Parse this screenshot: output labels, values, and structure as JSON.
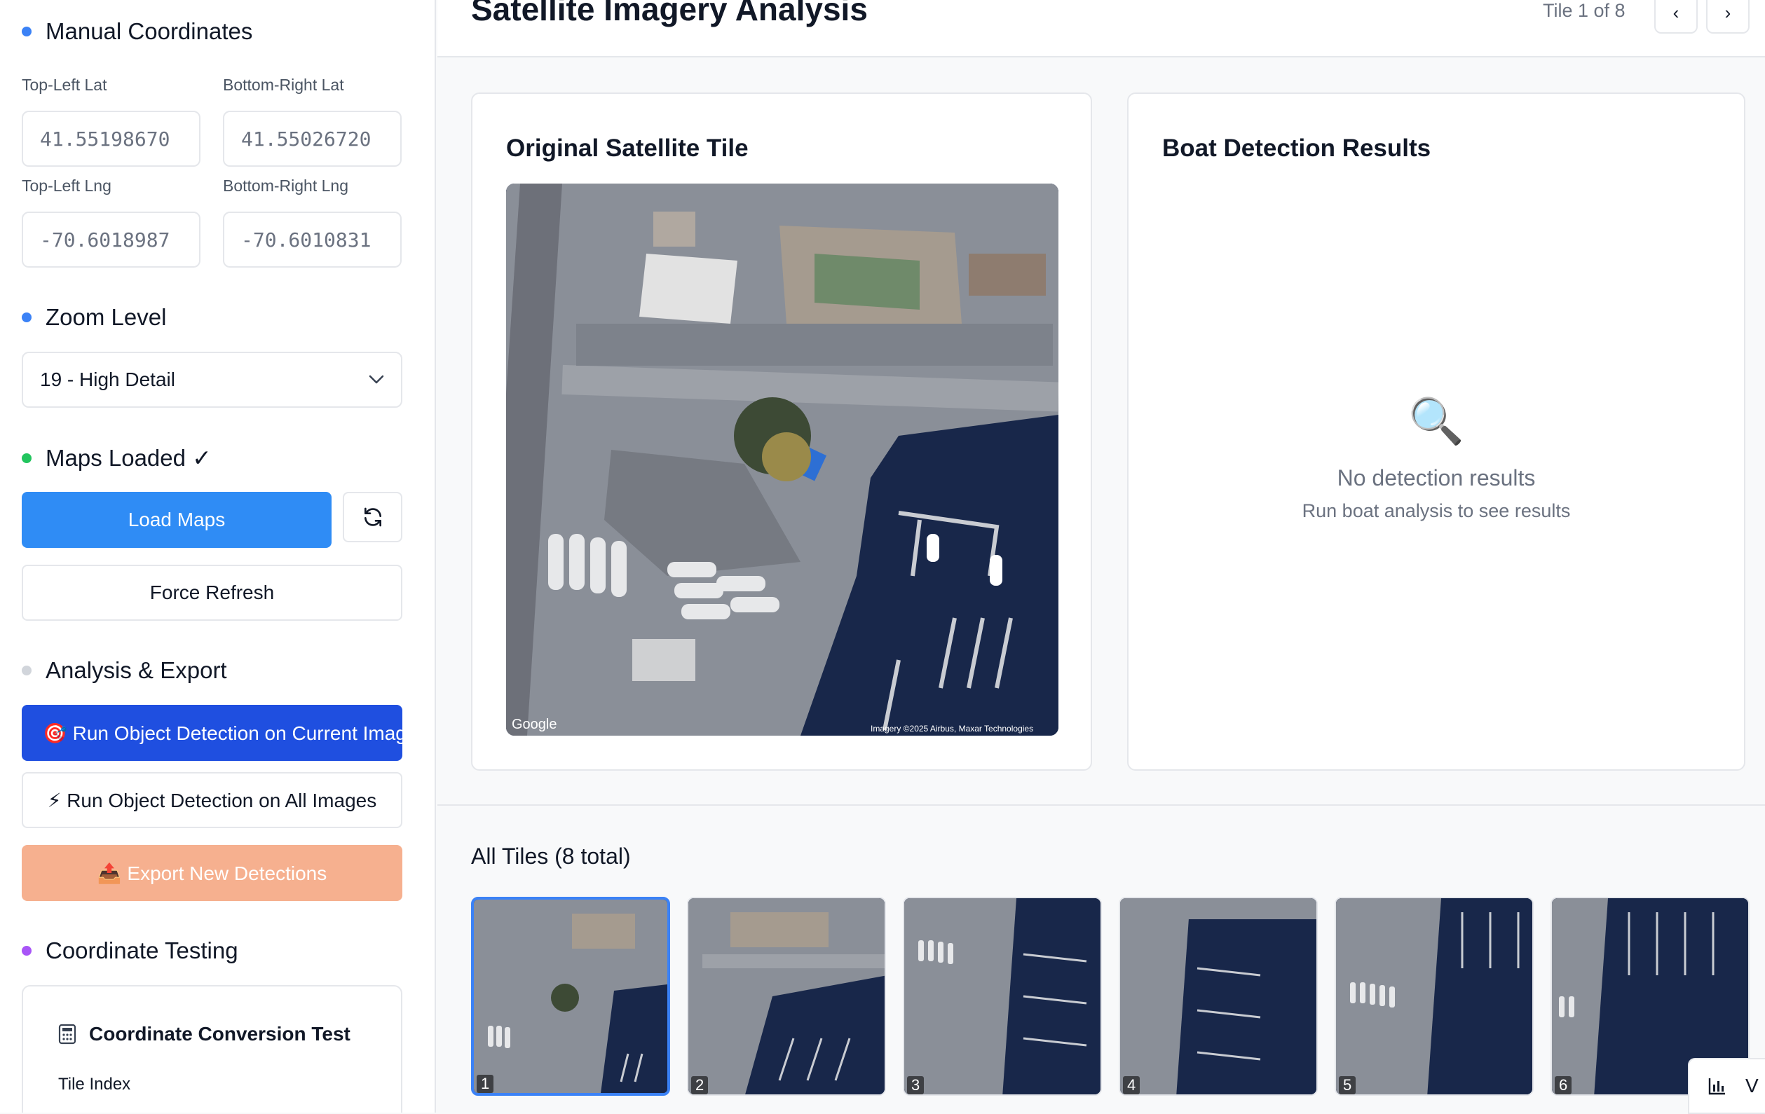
{
  "sidebar": {
    "manual": {
      "title": "Manual Coordinates",
      "top_left_lat_label": "Top-Left Lat",
      "bottom_right_lat_label": "Bottom-Right Lat",
      "top_left_lng_label": "Top-Left Lng",
      "bottom_right_lng_label": "Bottom-Right Lng",
      "top_left_lat_value": "41.55198670",
      "bottom_right_lat_value": "41.55026720",
      "top_left_lng_value": "-70.6018987",
      "bottom_right_lng_value": "-70.6010831"
    },
    "zoom": {
      "title": "Zoom Level",
      "selected": "19 - High Detail"
    },
    "maps": {
      "title": "Maps Loaded ✓",
      "load_label": "Load Maps",
      "force_refresh_label": "Force Refresh"
    },
    "analysis": {
      "title": "Analysis & Export",
      "run_current_label": "🎯 Run Object Detection on Current Image",
      "run_all_label": "⚡ Run Object Detection on All Images",
      "export_label": "📤 Export New Detections"
    },
    "testing": {
      "title": "Coordinate Testing",
      "card_title": "Coordinate Conversion Test",
      "tile_index_label": "Tile Index"
    }
  },
  "header": {
    "title": "Satellite Imagery Analysis",
    "tile_counter": "Tile 1 of 8",
    "prev_icon": "‹",
    "next_icon": "›"
  },
  "original_panel": {
    "title": "Original Satellite Tile",
    "watermark_left": "Google",
    "watermark_right": "Imagery ©2025 Airbus, Maxar Technologies"
  },
  "detection_panel": {
    "title": "Boat Detection Results",
    "empty_icon": "🔍",
    "empty_title": "No detection results",
    "empty_subtitle": "Run boat analysis to see results"
  },
  "tiles": {
    "title": "All Tiles (8 total)",
    "items": [
      {
        "num": "1",
        "active": true
      },
      {
        "num": "2",
        "active": false
      },
      {
        "num": "3",
        "active": false
      },
      {
        "num": "4",
        "active": false
      },
      {
        "num": "5",
        "active": false
      },
      {
        "num": "6",
        "active": false
      }
    ]
  },
  "floating": {
    "icon": "bar-chart-icon",
    "label": "V"
  },
  "colors": {
    "primary": "#2f8cf5",
    "run_current": "#1f4fe0",
    "export": "#f6b08f",
    "dot_blue": "#3b82f6",
    "dot_green": "#22c55e",
    "dot_gray": "#d1d5db",
    "dot_purple": "#a855f7",
    "water": "#1b2a4a"
  }
}
